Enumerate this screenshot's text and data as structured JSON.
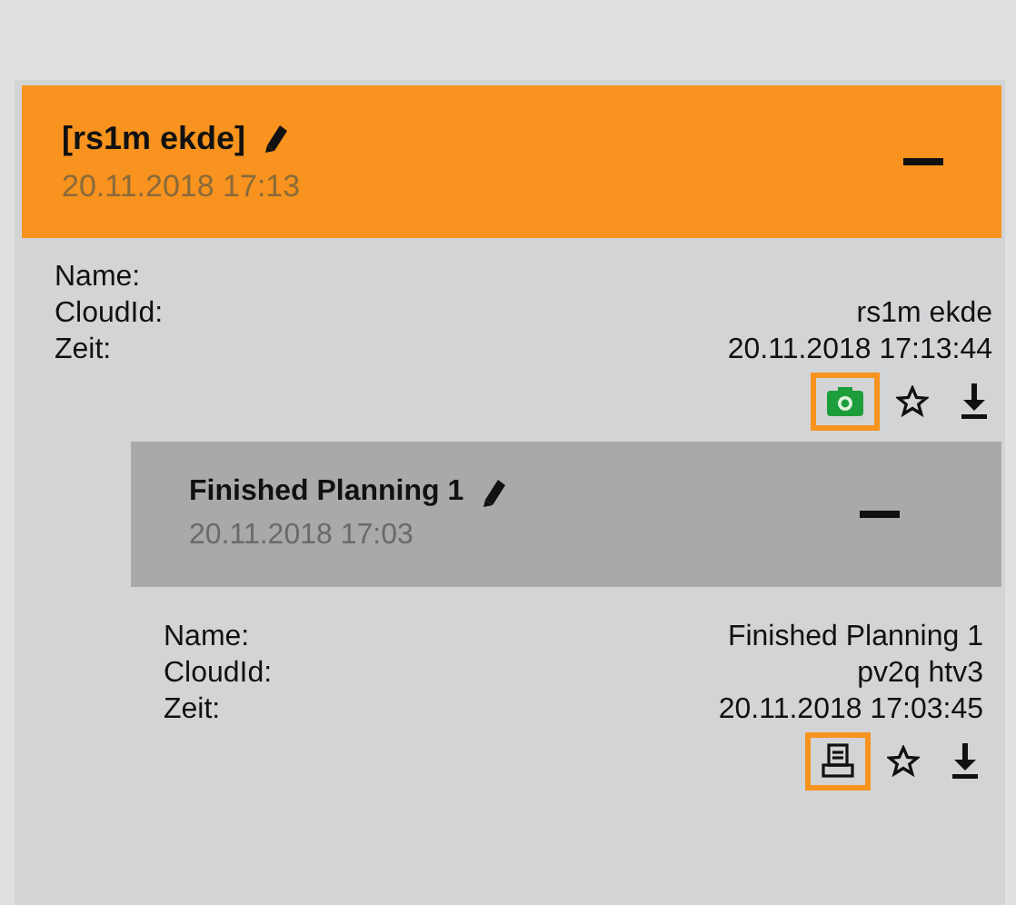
{
  "items": [
    {
      "title": "[rs1m ekde]",
      "date": "20.11.2018 17:13",
      "selected": true,
      "expanded": true,
      "fields": [
        {
          "label": "Name:"
        },
        {
          "label": "CloudId:",
          "value": "rs1m ekde"
        },
        {
          "label": "Zeit:",
          "value": "20.11.2018 17:13:44"
        }
      ],
      "actions": [
        {
          "kind": "camera",
          "highlighted": true
        },
        {
          "kind": "star",
          "highlighted": false
        },
        {
          "kind": "download",
          "highlighted": false
        }
      ],
      "children": [
        {
          "title": "Finished Planning 1",
          "date": "20.11.2018 17:03",
          "selected": false,
          "expanded": true,
          "fields": [
            {
              "label": "Name:",
              "value": "Finished Planning 1"
            },
            {
              "label": "CloudId:",
              "value": "pv2q htv3"
            },
            {
              "label": "Zeit:",
              "value": "20.11.2018 17:03:45"
            }
          ],
          "actions": [
            {
              "kind": "printer",
              "highlighted": true
            },
            {
              "kind": "star",
              "highlighted": false
            },
            {
              "kind": "download",
              "highlighted": false
            }
          ]
        }
      ]
    }
  ]
}
